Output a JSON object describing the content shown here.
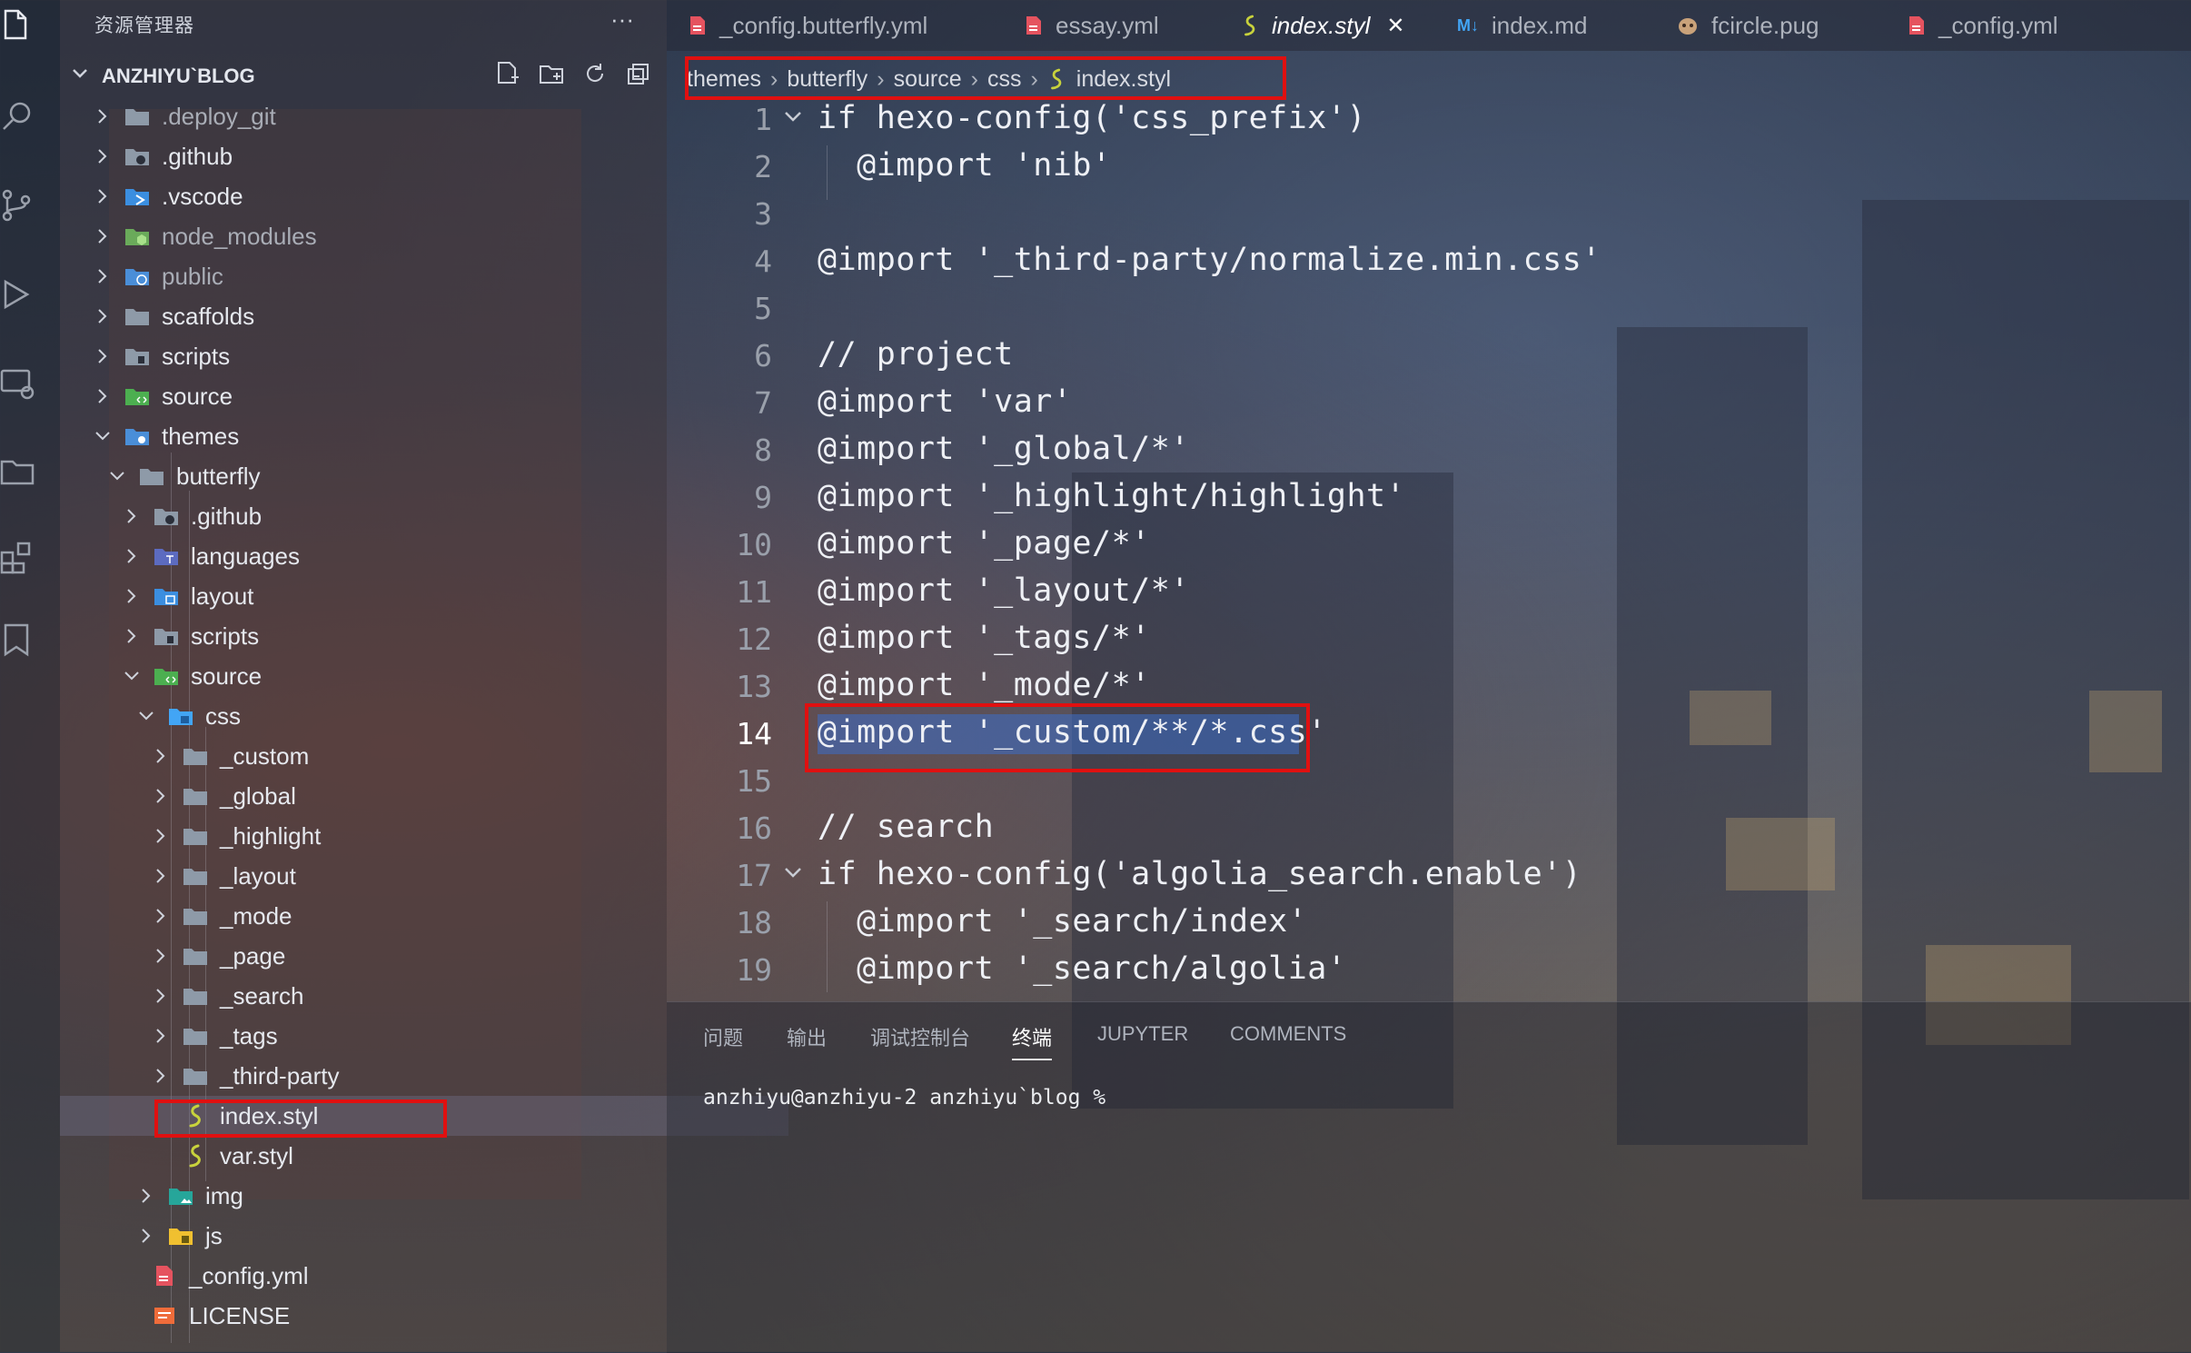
{
  "sidebar": {
    "title": "资源管理器",
    "more": "···",
    "project": "ANZHIYU`BLOG",
    "tree": [
      {
        "label": ".deploy_git",
        "dim": true
      },
      {
        "label": ".github"
      },
      {
        "label": ".vscode"
      },
      {
        "label": "node_modules",
        "dim": true
      },
      {
        "label": "public",
        "dim": true
      },
      {
        "label": "scaffolds"
      },
      {
        "label": "scripts"
      },
      {
        "label": "source"
      },
      {
        "label": "themes"
      },
      {
        "label": "butterfly"
      },
      {
        "label": ".github"
      },
      {
        "label": "languages"
      },
      {
        "label": "layout"
      },
      {
        "label": "scripts"
      },
      {
        "label": "source"
      },
      {
        "label": "css"
      },
      {
        "label": "_custom"
      },
      {
        "label": "_global"
      },
      {
        "label": "_highlight"
      },
      {
        "label": "_layout"
      },
      {
        "label": "_mode"
      },
      {
        "label": "_page"
      },
      {
        "label": "_search"
      },
      {
        "label": "_tags"
      },
      {
        "label": "_third-party"
      },
      {
        "label": "index.styl"
      },
      {
        "label": "var.styl"
      },
      {
        "label": "img"
      },
      {
        "label": "js"
      },
      {
        "label": "_config.yml"
      },
      {
        "label": "LICENSE"
      }
    ]
  },
  "tabs": [
    {
      "label": "_config.butterfly.yml",
      "icon": "yaml-file-icon"
    },
    {
      "label": "essay.yml",
      "icon": "yaml-file-icon"
    },
    {
      "label": "index.styl",
      "icon": "stylus-file-icon",
      "active": true,
      "close": "✕"
    },
    {
      "label": "index.md",
      "icon": "markdown-file-icon",
      "badge": "M↓"
    },
    {
      "label": "fcircle.pug",
      "icon": "pug-file-icon"
    },
    {
      "label": "_config.yml",
      "icon": "yaml-file-icon"
    }
  ],
  "breadcrumb": [
    "themes",
    "butterfly",
    "source",
    "css",
    "index.styl"
  ],
  "code": [
    {
      "n": "1",
      "text": "if hexo-config('css_prefix')"
    },
    {
      "n": "2",
      "text": "  @import 'nib'"
    },
    {
      "n": "3",
      "text": ""
    },
    {
      "n": "4",
      "text": "@import '_third-party/normalize.min.css'"
    },
    {
      "n": "5",
      "text": ""
    },
    {
      "n": "6",
      "text": "// project"
    },
    {
      "n": "7",
      "text": "@import 'var'"
    },
    {
      "n": "8",
      "text": "@import '_global/*'"
    },
    {
      "n": "9",
      "text": "@import '_highlight/highlight'"
    },
    {
      "n": "10",
      "text": "@import '_page/*'"
    },
    {
      "n": "11",
      "text": "@import '_layout/*'"
    },
    {
      "n": "12",
      "text": "@import '_tags/*'"
    },
    {
      "n": "13",
      "text": "@import '_mode/*'"
    },
    {
      "n": "14",
      "text": "@import '_custom/**/*.css'",
      "current": true
    },
    {
      "n": "15",
      "text": ""
    },
    {
      "n": "16",
      "text": "// search"
    },
    {
      "n": "17",
      "text": "if hexo-config('algolia_search.enable')"
    },
    {
      "n": "18",
      "text": "  @import '_search/index'"
    },
    {
      "n": "19",
      "text": "  @import '_search/algolia'"
    }
  ],
  "panel": {
    "tabs": [
      "问题",
      "输出",
      "调试控制台",
      "终端",
      "JUPYTER",
      "COMMENTS"
    ],
    "active": "终端",
    "prompt": "anzhiyu@anzhiyu-2 anzhiyu`blog %"
  },
  "colors": {
    "highlight_border": "#e01010",
    "selection": "#3c6ec8",
    "stylus_icon": "#c8d23c"
  }
}
